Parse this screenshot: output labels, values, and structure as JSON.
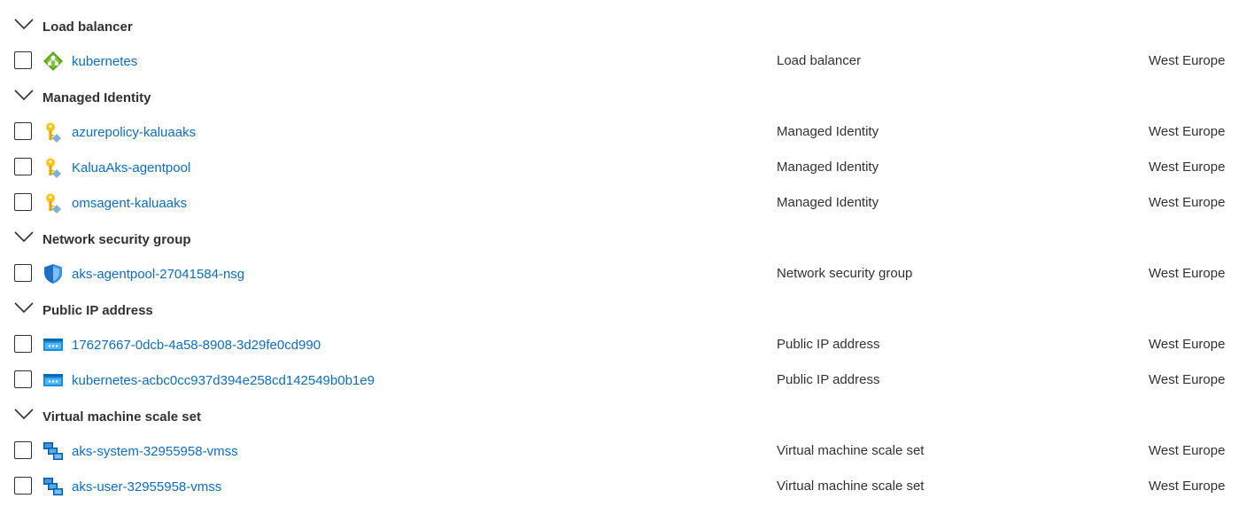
{
  "groups": [
    {
      "title": "Load balancer",
      "items": [
        {
          "name": "kubernetes",
          "type": "Load balancer",
          "location": "West Europe",
          "icon": "load-balancer-icon"
        }
      ]
    },
    {
      "title": "Managed Identity",
      "items": [
        {
          "name": "azurepolicy-kaluaaks",
          "type": "Managed Identity",
          "location": "West Europe",
          "icon": "managed-identity-icon"
        },
        {
          "name": "KaluaAks-agentpool",
          "type": "Managed Identity",
          "location": "West Europe",
          "icon": "managed-identity-icon"
        },
        {
          "name": "omsagent-kaluaaks",
          "type": "Managed Identity",
          "location": "West Europe",
          "icon": "managed-identity-icon"
        }
      ]
    },
    {
      "title": "Network security group",
      "items": [
        {
          "name": "aks-agentpool-27041584-nsg",
          "type": "Network security group",
          "location": "West Europe",
          "icon": "network-security-group-icon"
        }
      ]
    },
    {
      "title": "Public IP address",
      "items": [
        {
          "name": "17627667-0dcb-4a58-8908-3d29fe0cd990",
          "type": "Public IP address",
          "location": "West Europe",
          "icon": "public-ip-icon"
        },
        {
          "name": "kubernetes-acbc0cc937d394e258cd142549b0b1e9",
          "type": "Public IP address",
          "location": "West Europe",
          "icon": "public-ip-icon"
        }
      ]
    },
    {
      "title": "Virtual machine scale set",
      "items": [
        {
          "name": "aks-system-32955958-vmss",
          "type": "Virtual machine scale set",
          "location": "West Europe",
          "icon": "vmss-icon"
        },
        {
          "name": "aks-user-32955958-vmss",
          "type": "Virtual machine scale set",
          "location": "West Europe",
          "icon": "vmss-icon"
        }
      ]
    }
  ]
}
